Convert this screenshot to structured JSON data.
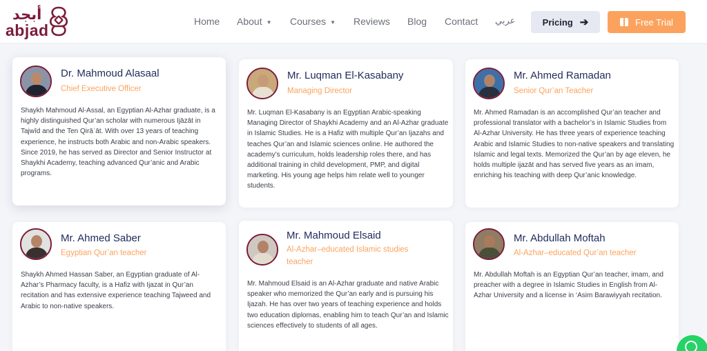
{
  "brand": {
    "logo_arabic": "أبجد",
    "logo_latin": "abjad"
  },
  "nav": {
    "home": "Home",
    "about": "About",
    "courses": "Courses",
    "reviews": "Reviews",
    "blog": "Blog",
    "contact": "Contact",
    "arabic": "عربي",
    "pricing": "Pricing",
    "free_trial": "Free Trial"
  },
  "colors": {
    "accent": "#fba35e",
    "brand": "#7a1c3a",
    "name": "#1f2a5a"
  },
  "team": [
    {
      "name": "Dr. Mahmoud Alasaal",
      "role": "Chief Executive Officer",
      "bio": "Shaykh Mahmoud Al-Assal, an Egyptian Al-Azhar graduate, is a highly distinguished Qur’an scholar with numerous Ijāzāt in Tajwīd and the Ten Qirāʾāt. With over 13 years of teaching experience, he instructs both Arabic and non-Arabic speakers. Since 2019, he has served as Director and Senior Instructor at Shaykhi Academy, teaching advanced Qur’anic and Arabic programs."
    },
    {
      "name": "Mr. Luqman El-Kasabany",
      "role": "Managing Director",
      "bio": "Mr. Luqman El-Kasabany is an Egyptian Arabic-speaking Managing Director of Shaykhi Academy and an Al-Azhar graduate in Islamic Studies. He is a Hafiz with multiple Qur’an Ijazahs and teaches Qur’an and Islamic sciences online. He authored the academy’s curriculum, holds leadership roles there, and has additional training in child development, PMP, and digital marketing. His young age helps him relate well to younger students."
    },
    {
      "name": "Mr. Ahmed Ramadan",
      "role": "Senior Qur’an Teacher",
      "bio": "Mr. Ahmed Ramadan is an accomplished Qur’an teacher and professional translator with a bachelor’s in Islamic Studies from Al-Azhar University. He has three years of experience teaching Arabic and Islamic Studies to non-native speakers and translating Islamic and legal texts. Memorized the Qur’an by age eleven, he holds multiple ijazāt and has served five years as an imam, enriching his teaching with deep Qur’anic knowledge."
    },
    {
      "name": "Mr. Ahmed Saber",
      "role": "Egyptian Qur’an teacher",
      "bio": "Shaykh Ahmed Hassan Saber, an Egyptian graduate of Al-Azhar’s Pharmacy faculty, is a Hafiz with Ijazat in Qur’an recitation and has extensive experience teaching Tajweed and Arabic to non-native speakers."
    },
    {
      "name": "Mr. Mahmoud Elsaid",
      "role": "Al-Azhar–educated Islamic studies teacher",
      "bio": "Mr. Mahmoud Elsaid is an Al-Azhar graduate and native Arabic speaker who memorized the Qur’an early and is pursuing his Ijazah. He has over two years of teaching experience and holds two education diplomas, enabling him to teach Qur’an and Islamic sciences effectively to students of all ages."
    },
    {
      "name": "Mr. Abdullah Moftah",
      "role": "Al-Azhar–educated Qur’an teacher",
      "bio": "Mr. Abdullah Moftah is an Egyptian Qur’an teacher, imam, and preacher with a degree in Islamic Studies in English from Al-Azhar University and a license in ‘Asim Barawiyyah recitation."
    }
  ]
}
